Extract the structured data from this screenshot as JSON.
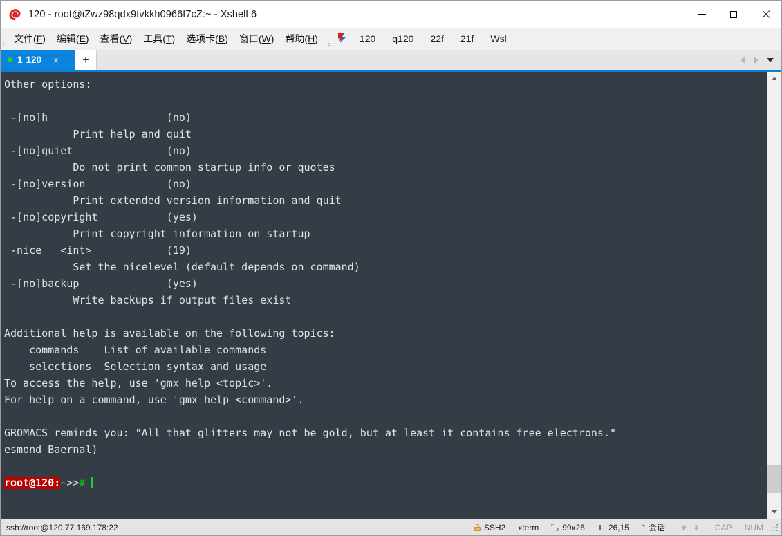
{
  "window": {
    "title": "120 - root@iZwz98qdx9tvkkh0966f7cZ:~ - Xshell 6",
    "app_icon": "xshell-logo-icon",
    "minimize_label": "Minimize",
    "maximize_label": "Maximize",
    "close_label": "Close"
  },
  "menu": {
    "items": [
      {
        "pre": "文件(",
        "key": "F",
        "post": ")",
        "name": "menu-file"
      },
      {
        "pre": "编辑(",
        "key": "E",
        "post": ")",
        "name": "menu-edit"
      },
      {
        "pre": "查看(",
        "key": "V",
        "post": ")",
        "name": "menu-view"
      },
      {
        "pre": "工具(",
        "key": "T",
        "post": ")",
        "name": "menu-tools"
      },
      {
        "pre": "选项卡(",
        "key": "B",
        "post": ")",
        "name": "menu-tabs"
      },
      {
        "pre": "窗口(",
        "key": "W",
        "post": ")",
        "name": "menu-window"
      },
      {
        "pre": "帮助(",
        "key": "H",
        "post": ")",
        "name": "menu-help"
      }
    ]
  },
  "toolbar": {
    "flag_icon": "red-blue-flag-icon",
    "links": [
      {
        "label": "120"
      },
      {
        "label": "q120"
      },
      {
        "label": "22f"
      },
      {
        "label": "21f"
      },
      {
        "label": "Wsl"
      }
    ]
  },
  "tabs": {
    "active": {
      "index": "1",
      "label": "120",
      "close_glyph": "×",
      "status_dot_color": "#29d02c"
    },
    "new_tab_glyph": "+",
    "nav": {
      "left_icon": "chevron-left-icon",
      "right_icon": "chevron-right-icon",
      "dropdown_icon": "chevron-down-icon"
    }
  },
  "terminal": {
    "lines": [
      "Other options:",
      "",
      " -[no]h                   (no)",
      "           Print help and quit",
      " -[no]quiet               (no)",
      "           Do not print common startup info or quotes",
      " -[no]version             (no)",
      "           Print extended version information and quit",
      " -[no]copyright           (yes)",
      "           Print copyright information on startup",
      " -nice   <int>            (19)",
      "           Set the nicelevel (default depends on command)",
      " -[no]backup              (yes)",
      "           Write backups if output files exist",
      "",
      "Additional help is available on the following topics:",
      "    commands    List of available commands",
      "    selections  Selection syntax and usage",
      "To access the help, use 'gmx help <topic>'.",
      "For help on a command, use 'gmx help <command>'.",
      "",
      "GROMACS reminds you: \"All that glitters may not be gold, but at least it contains free electrons.\"",
      "esmond Baernal)",
      ""
    ],
    "prompt": {
      "host": "root@120:",
      "path": "~",
      "arrows": ">>",
      "hash": "#",
      "input": ""
    }
  },
  "scrollbar": {
    "up_icon": "scroll-up-arrow-icon",
    "down_icon": "scroll-down-arrow-icon",
    "thumb_top_pct": 90.5,
    "thumb_height_pct": 6.5
  },
  "statusbar": {
    "connection": "ssh://root@120.77.169.178:22",
    "protocol": "SSH2",
    "protocol_icon": "lock-icon",
    "terminal_type": "xterm",
    "size": "99x26",
    "size_icon": "screen-size-icon",
    "cursor_pos": "26,15",
    "cursor_icon": "cursor-position-icon",
    "sessions": "1 会话",
    "transfer_up_icon": "arrow-up-icon",
    "transfer_down_icon": "arrow-down-icon",
    "caps": "CAP",
    "num": "NUM",
    "resize_grip_icon": "resize-grip-icon"
  }
}
